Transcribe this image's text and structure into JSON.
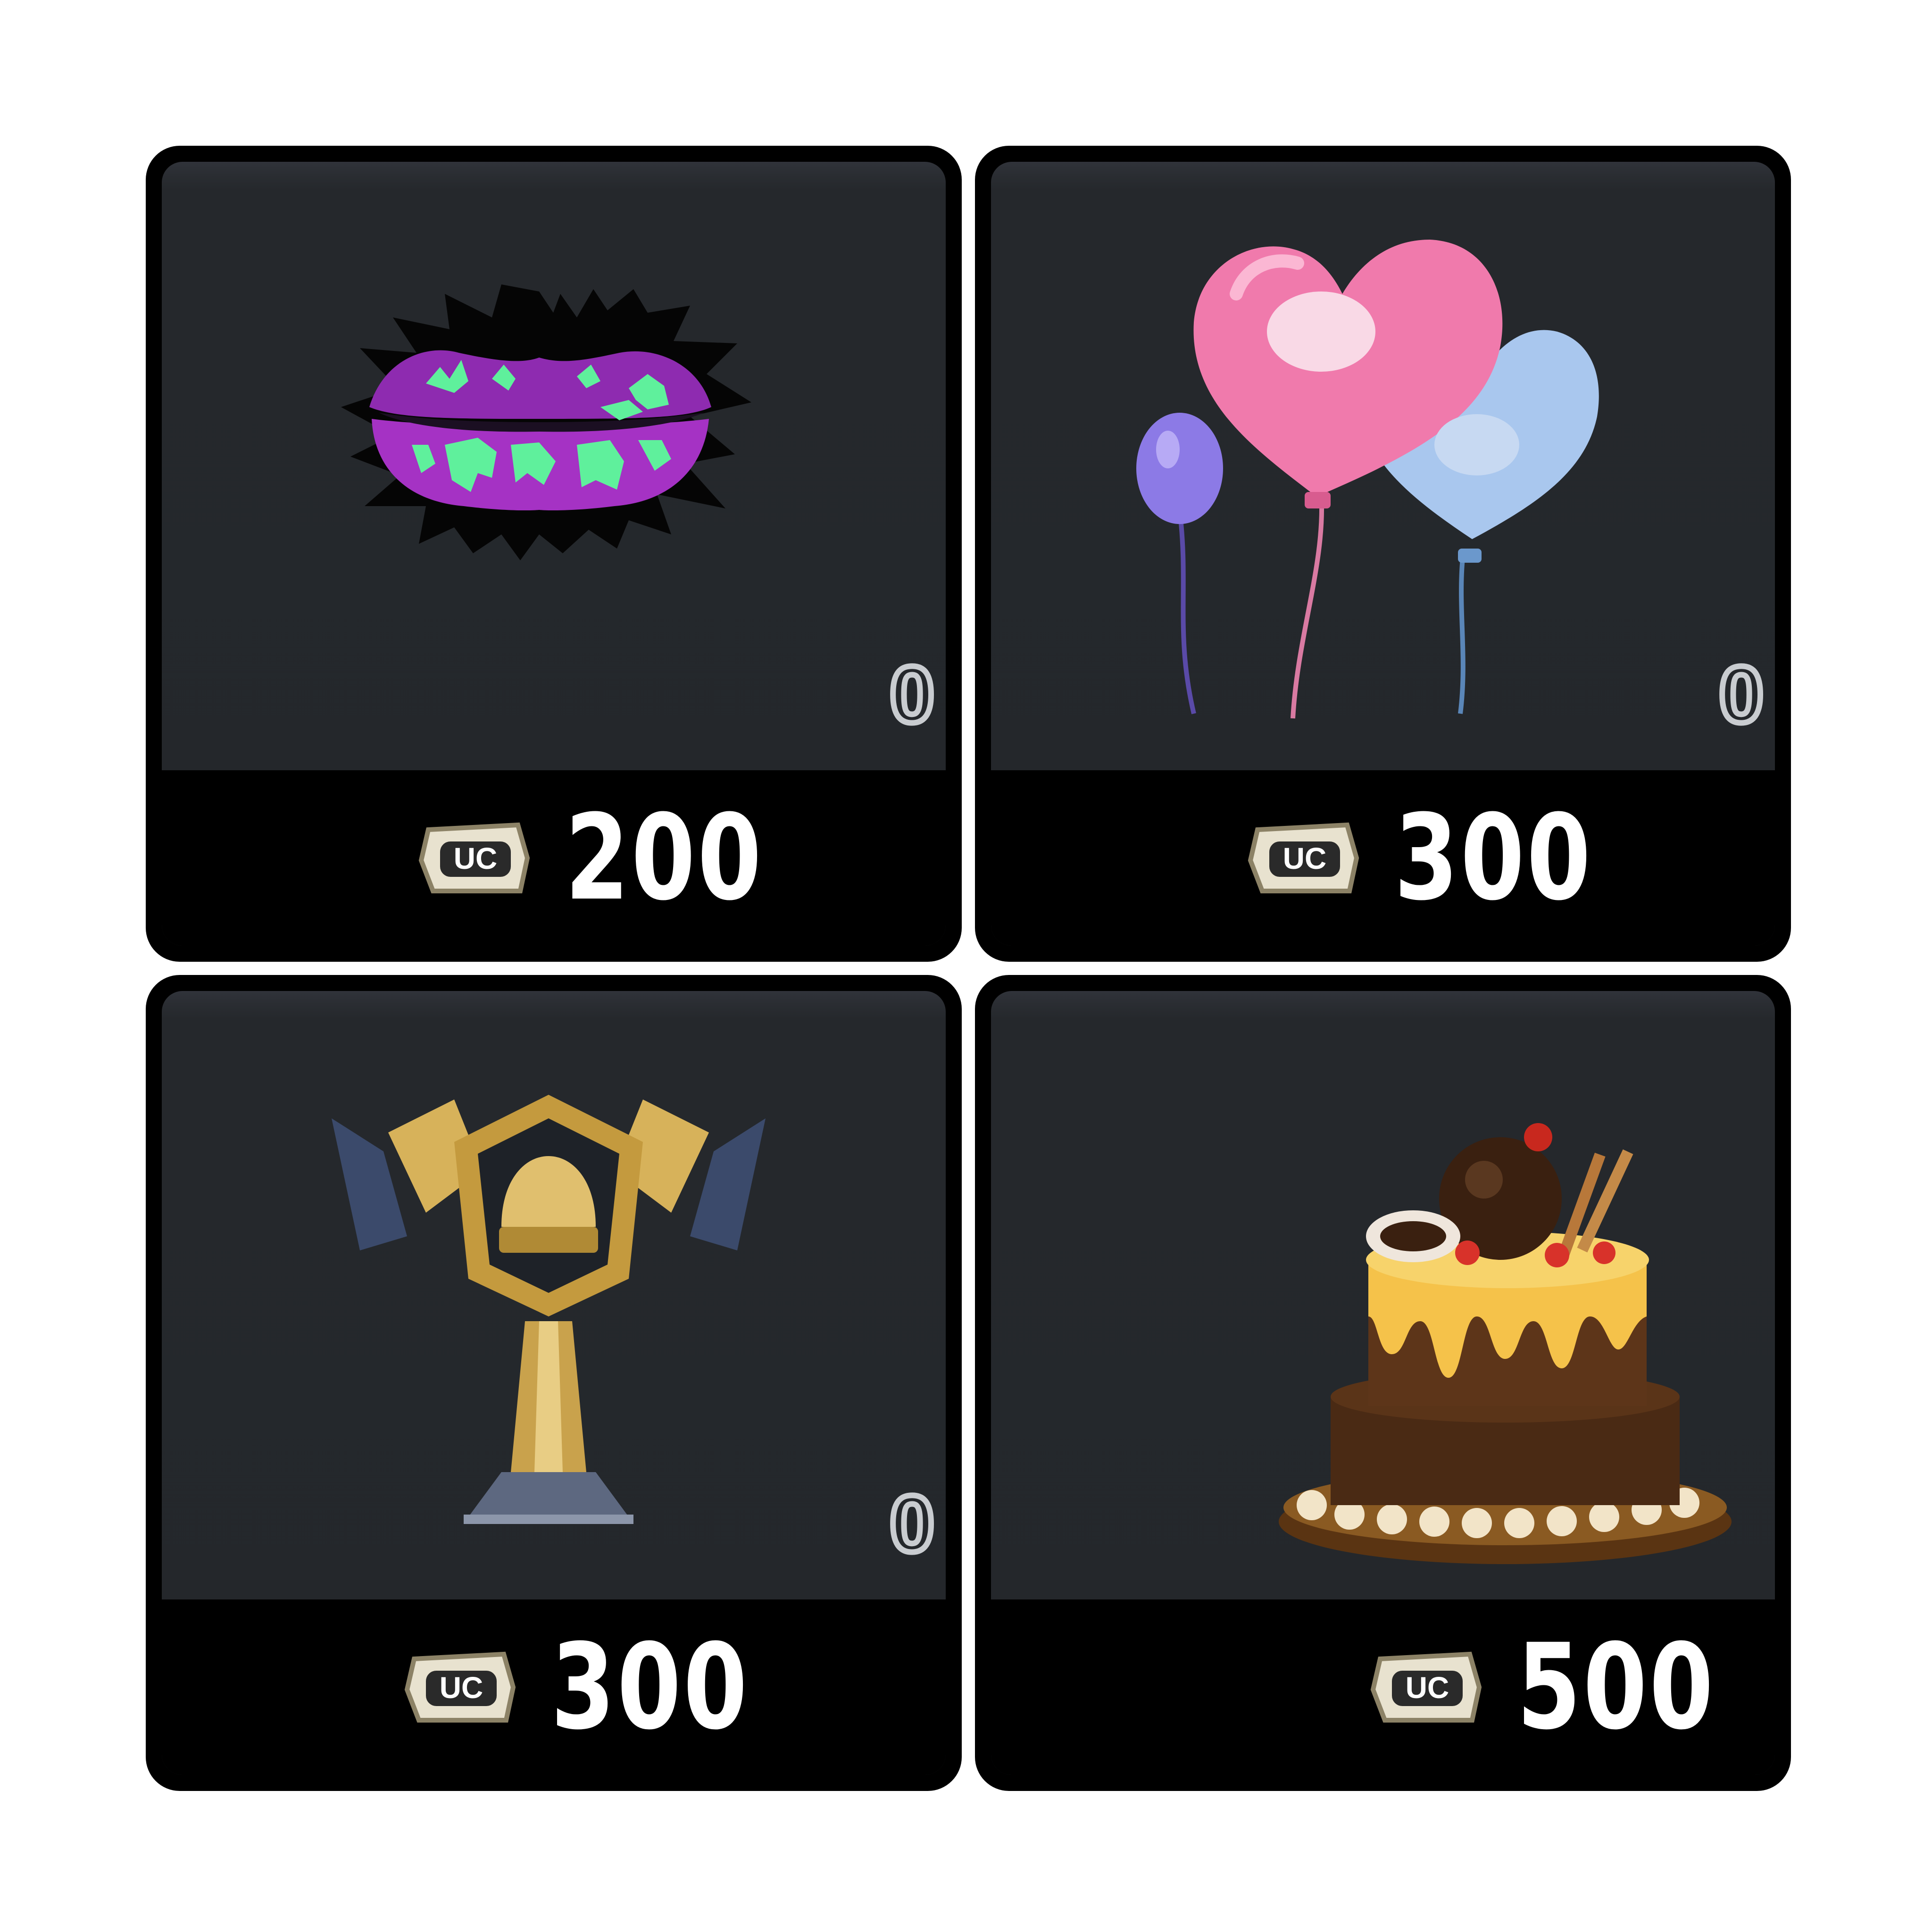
{
  "items": [
    {
      "name": "lips-spray",
      "art_icon": "purple-lips-splash-icon",
      "quantity": "0",
      "price": "200",
      "currency": "uc-coin-icon"
    },
    {
      "name": "heart-balloons",
      "art_icon": "heart-balloons-icon",
      "quantity": "0",
      "price": "300",
      "currency": "uc-coin-icon"
    },
    {
      "name": "golden-trophy",
      "art_icon": "golden-trophy-icon",
      "quantity": "0",
      "price": "300",
      "currency": "uc-coin-icon"
    },
    {
      "name": "chocolate-cake",
      "art_icon": "chocolate-cake-icon",
      "quantity": "",
      "price": "500",
      "currency": "uc-coin-icon"
    }
  ],
  "colors": {
    "card_border": "#000000",
    "card_background": "#24272b",
    "price_text": "#ffffff"
  }
}
